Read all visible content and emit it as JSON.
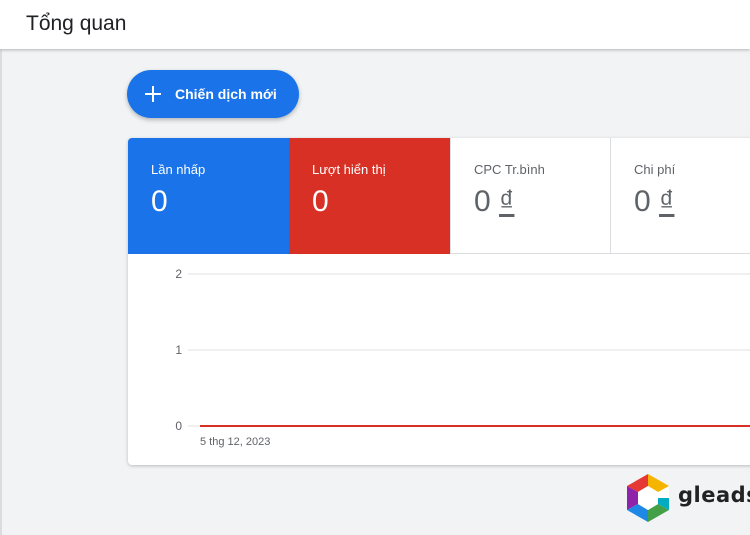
{
  "header": {
    "title": "Tổng quan"
  },
  "new_campaign": {
    "label": "Chiến dịch mới",
    "icon": "plus-icon"
  },
  "metrics": [
    {
      "label": "Lần nhấp",
      "value": "0",
      "color": "#1a73e8"
    },
    {
      "label": "Lượt hiển thị",
      "value": "0",
      "color": "#d93025"
    },
    {
      "label": "CPC Tr.bình",
      "value": "0",
      "currency": "₫"
    },
    {
      "label": "Chi phí",
      "value": "0",
      "currency": "₫"
    }
  ],
  "chart_data": {
    "type": "line",
    "y_ticks": [
      "2",
      "1",
      "0"
    ],
    "ylim": [
      0,
      2
    ],
    "x_label_start": "5 thg 12, 2023",
    "series": [
      {
        "values": [
          0,
          0
        ],
        "color": "#d93025"
      }
    ],
    "grid": true
  },
  "logo": {
    "text": "gleads"
  }
}
